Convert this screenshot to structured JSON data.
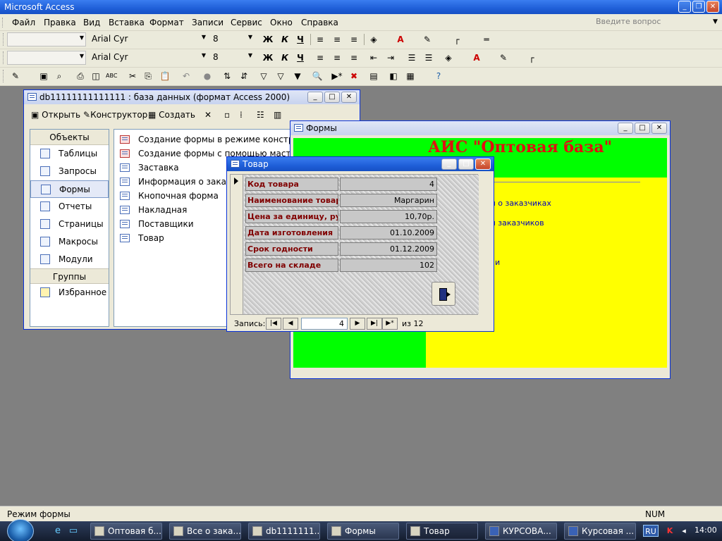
{
  "app": {
    "title": "Microsoft Access"
  },
  "menu": {
    "items": [
      "Файл",
      "Правка",
      "Вид",
      "Вставка",
      "Формат",
      "Записи",
      "Сервис",
      "Окно",
      "Справка"
    ],
    "question_placeholder": "Введите вопрос"
  },
  "formatting": {
    "row1": {
      "font": "Arial Cyr",
      "size": "8"
    },
    "row2": {
      "font": "Arial Cyr",
      "size": "8"
    }
  },
  "db_window": {
    "title": "db11111111111111 : база данных (формат Access 2000)",
    "toolbar": {
      "open": "Открыть",
      "design": "Конструктор",
      "create": "Создать"
    },
    "objects_header": "Объекты",
    "objects": [
      "Таблицы",
      "Запросы",
      "Формы",
      "Отчеты",
      "Страницы",
      "Макросы",
      "Модули"
    ],
    "groups_header": "Группы",
    "groups": [
      "Избранное"
    ],
    "forms_list": [
      "Создание формы в режиме конструкто",
      "Создание формы с помощью мастера",
      "Заставка",
      "Информация о заказч",
      "Кнопочная форма",
      "Накладная",
      "Поставщики",
      "Товар"
    ]
  },
  "forms_window": {
    "title": "Формы",
    "heading": "АИС \"Оптовая база\"",
    "links": [
      "ия о заказчиках",
      "ия заказчиков",
      "и"
    ]
  },
  "tovar_window": {
    "title": "Товар",
    "fields": [
      {
        "label": "Код товара",
        "value": "4"
      },
      {
        "label": "Наименование товара",
        "value": "Маргарин"
      },
      {
        "label": "Цена за единицу, руб",
        "value": "10,70р."
      },
      {
        "label": "Дата изготовления",
        "value": "01.10.2009"
      },
      {
        "label": "Срок годности",
        "value": "01.12.2009"
      },
      {
        "label": "Всего на складе",
        "value": "102"
      }
    ],
    "nav": {
      "label": "Запись:",
      "current": "4",
      "of": "из",
      "total": "12"
    }
  },
  "statusbar": {
    "mode": "Режим формы",
    "num": "NUM"
  },
  "taskbar": {
    "items": [
      "Оптовая б...",
      "Все о зака...",
      "db1111111...",
      "Формы",
      "Товар",
      "КУРСОВА...",
      "Курсовая ..."
    ],
    "lang": "RU",
    "clock": "14:00"
  }
}
